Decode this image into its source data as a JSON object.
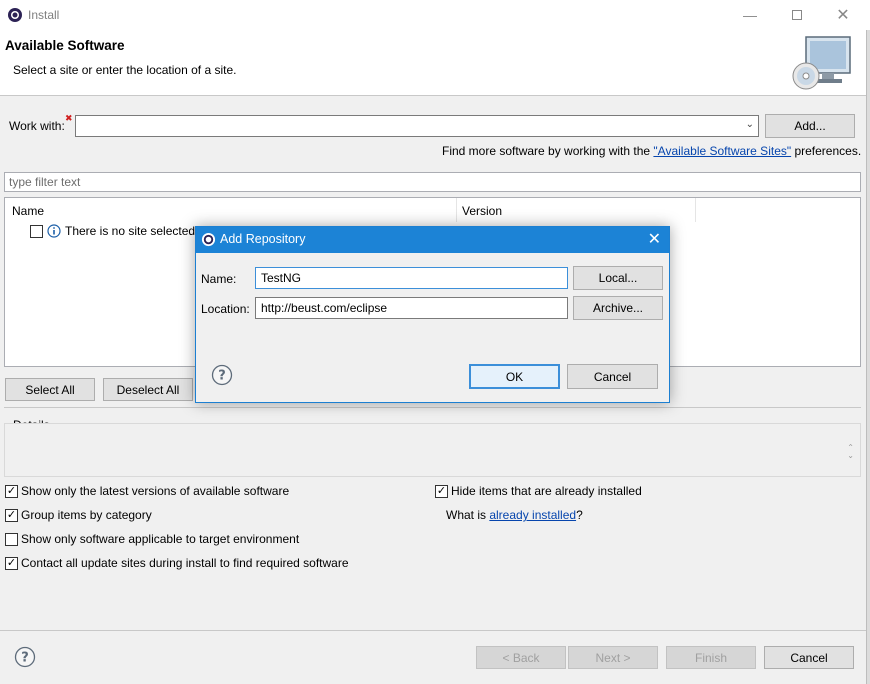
{
  "window": {
    "title": "Install"
  },
  "header": {
    "title": "Available Software",
    "subtitle": "Select a site or enter the location of a site."
  },
  "work_with": {
    "label": "Work with:",
    "value": "",
    "add_button": "Add...",
    "find_more_prefix": "Find more software by working with the ",
    "find_more_link": "\"Available Software Sites\"",
    "find_more_suffix": " preferences."
  },
  "filter": {
    "placeholder": "type filter text"
  },
  "table": {
    "columns": [
      "Name",
      "Version"
    ],
    "rows": [
      {
        "name": "There is no site selected.",
        "checked": false
      }
    ]
  },
  "selection_buttons": {
    "select_all": "Select All",
    "deselect_all": "Deselect All"
  },
  "details": {
    "label": "Details"
  },
  "options": [
    {
      "label": "Show only the latest versions of available software",
      "checked": true
    },
    {
      "label": "Group items by category",
      "checked": true
    },
    {
      "label": "Show only software applicable to target environment",
      "checked": false
    },
    {
      "label": "Contact all update sites during install to find required software",
      "checked": true
    },
    {
      "label": "Hide items that are already installed",
      "checked": true
    }
  ],
  "already_installed": {
    "prefix": "What is ",
    "link": "already installed",
    "suffix": "?"
  },
  "footer": {
    "back": "< Back",
    "next": "Next >",
    "finish": "Finish",
    "cancel": "Cancel"
  },
  "dialog": {
    "title": "Add Repository",
    "name_label": "Name:",
    "name_value": "TestNG",
    "location_label": "Location:",
    "location_value": "http://beust.com/eclipse",
    "local_button": "Local...",
    "archive_button": "Archive...",
    "ok_button": "OK",
    "cancel_button": "Cancel"
  },
  "colors": {
    "accent": "#1c83d6",
    "link": "#0645ad",
    "required": "#d02020"
  }
}
